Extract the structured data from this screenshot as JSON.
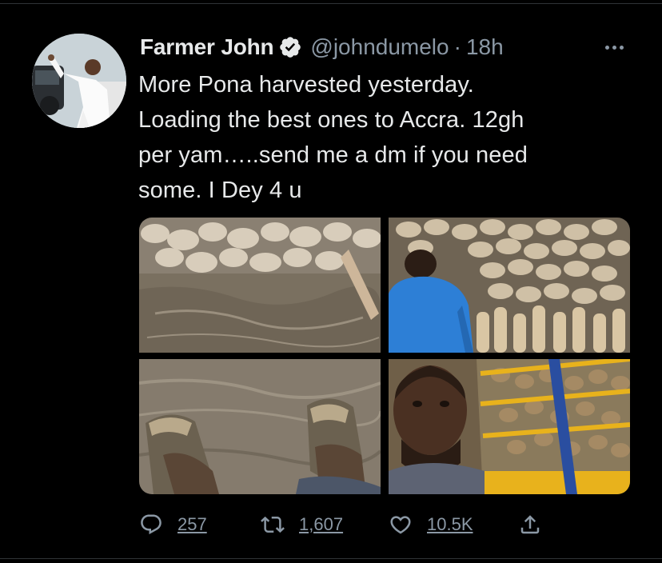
{
  "tweet": {
    "author": {
      "display_name": "Farmer John",
      "handle": "@johndumelo",
      "verified": true
    },
    "separator": "·",
    "time_ago": "18h",
    "text": "More Pona  harvested yesterday.\nLoading the best ones to Accra. 12gh\nper yam…..send me a dm if you need\nsome. I Dey 4 u",
    "actions": {
      "replies": "257",
      "retweets": "1,607",
      "likes": "10.5K"
    }
  },
  "colors": {
    "background": "#000000",
    "text_primary": "#e7e9ea",
    "text_secondary": "#8b98a5",
    "verified_badge": "#e7e9ea",
    "divider": "#2f3336"
  },
  "icons": {
    "verified": "verified-badge-icon",
    "more": "more-icon",
    "reply": "reply-icon",
    "retweet": "retweet-icon",
    "like": "heart-icon",
    "share": "share-icon"
  }
}
